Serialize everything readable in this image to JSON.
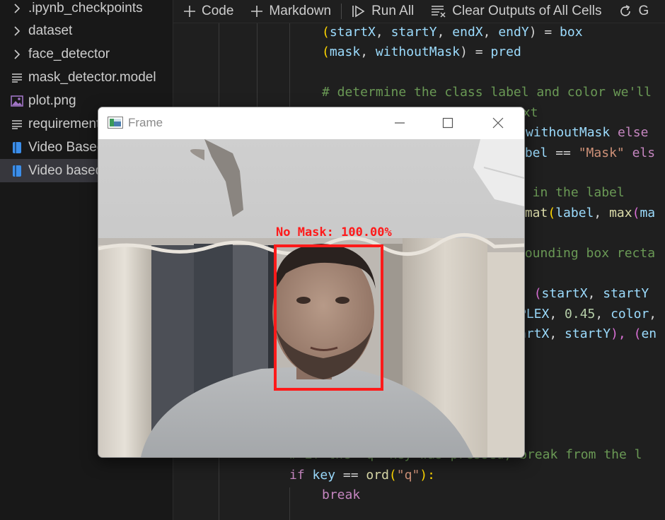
{
  "sidebar": {
    "items": [
      {
        "label": ".ipynb_checkpoints",
        "icon": "chevron-right-icon",
        "selected": false
      },
      {
        "label": "dataset",
        "icon": "chevron-right-icon",
        "selected": false
      },
      {
        "label": "face_detector",
        "icon": "chevron-right-icon",
        "selected": false
      },
      {
        "label": "mask_detector.model",
        "icon": "lines-file-icon",
        "selected": false
      },
      {
        "label": "plot.png",
        "icon": "image-file-icon",
        "selected": false
      },
      {
        "label": "requirements.txt",
        "icon": "lines-file-icon",
        "selected": false
      },
      {
        "label": "Video Based",
        "icon": "notebook-icon",
        "selected": false
      },
      {
        "label": "Video based",
        "icon": "notebook-icon",
        "selected": true
      }
    ]
  },
  "toolbar": {
    "code_label": "Code",
    "markdown_label": "Markdown",
    "run_all_label": "Run All",
    "clear_outputs_label": "Clear Outputs of All Cells",
    "cut_label": "G"
  },
  "code": {
    "line1": [
      "(",
      "startX",
      ", ",
      "startY",
      ", ",
      "endX",
      ", ",
      "endY",
      ") = ",
      "box"
    ],
    "line2": [
      "(",
      "mask",
      ", ",
      "withoutMask",
      ") = ",
      "pred"
    ],
    "line3": "# determine the class label and color we'll",
    "line4": "ext",
    "line5": [
      "withoutMask",
      " else"
    ],
    "line6": [
      "abel",
      " == ",
      "\"Mask\"",
      " els"
    ],
    "line7": "y in the label",
    "line8": [
      "rmat",
      "(",
      "label",
      ", ",
      "max",
      "(",
      "ma"
    ],
    "line9": "bounding box recta",
    "line10": [
      ", ",
      "(",
      "startX",
      ", ",
      "startY"
    ],
    "line11": [
      "PLEX",
      ", ",
      "0.45",
      ", ",
      "color",
      ","
    ],
    "line12": [
      "artX",
      ", ",
      "startY",
      "), ",
      "(",
      "en"
    ],
    "line13": "# if the 'q' key was pressed, break from the l",
    "line14": [
      "if",
      " ",
      "key",
      " == ",
      "ord",
      "(",
      "\"q\"",
      "):"
    ],
    "line15": "break"
  },
  "frame_window": {
    "title": "Frame",
    "detection_label": "No Mask: 100.00%",
    "box_color": "#ff1a1a"
  },
  "colors": {
    "accent_selected": "#37373d",
    "comment": "#6a9955",
    "variable": "#9cdcfe",
    "keyword": "#c586c0",
    "string": "#ce9178"
  }
}
